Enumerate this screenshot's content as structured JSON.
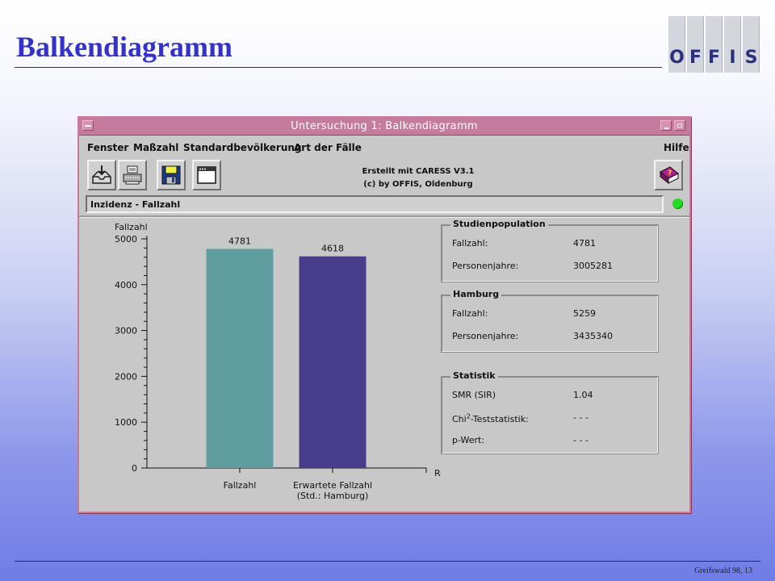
{
  "slide": {
    "title": "Balkendiagramm",
    "logo_letters": [
      "O",
      "F",
      "F",
      "I",
      "S"
    ],
    "footer": "Greifswald 98, 13"
  },
  "window": {
    "title": "Untersuchung 1: Balkendiagramm",
    "menu": [
      "Fenster",
      "Maßzahl",
      "Standardbevölkerung",
      "Art der Fälle",
      "Hilfe"
    ],
    "toolbar_icons": [
      "inbox-icon",
      "printer-icon",
      "floppy-disk-icon",
      "window-icon",
      "help-book-icon"
    ],
    "credit_line1": "Erstellt mit CARESS V3.1",
    "credit_line2": "(c) by OFFIS, Oldenburg",
    "status_text": "Inzidenz - Fallzahl",
    "status_color": "#22dd22",
    "title_bar_color": "#c47b9c"
  },
  "boxes": {
    "studienpopulation": {
      "title": "Studienpopulation",
      "rows": [
        {
          "label": "Fallzahl:",
          "value": "4781"
        },
        {
          "label": "Personenjahre:",
          "value": "3005281"
        }
      ]
    },
    "hamburg": {
      "title": "Hamburg",
      "rows": [
        {
          "label": "Fallzahl:",
          "value": "5259"
        },
        {
          "label": "Personenjahre:",
          "value": "3435340"
        }
      ]
    },
    "statistik": {
      "title": "Statistik",
      "rows": [
        {
          "label": "SMR (SIR)",
          "value": "1.04"
        },
        {
          "label": "Chi",
          "sup": "2",
          "label_suffix": "-Teststatistik:",
          "value": "- - -"
        },
        {
          "label": "p-Wert:",
          "value": "- - -"
        }
      ]
    }
  },
  "chart_data": {
    "type": "bar",
    "ylabel": "Fallzahl",
    "xlabel": "Region",
    "ylim": [
      0,
      5000
    ],
    "yticks": [
      0,
      1000,
      2000,
      3000,
      4000,
      5000
    ],
    "categories": [
      "Fallzahl",
      "Erwartete Fallzahl\n(Std.: Hamburg)"
    ],
    "values": [
      4781,
      4618
    ],
    "value_labels": [
      "4781",
      "4618"
    ],
    "colors": [
      "#5f9ea0",
      "#483d8b"
    ]
  }
}
